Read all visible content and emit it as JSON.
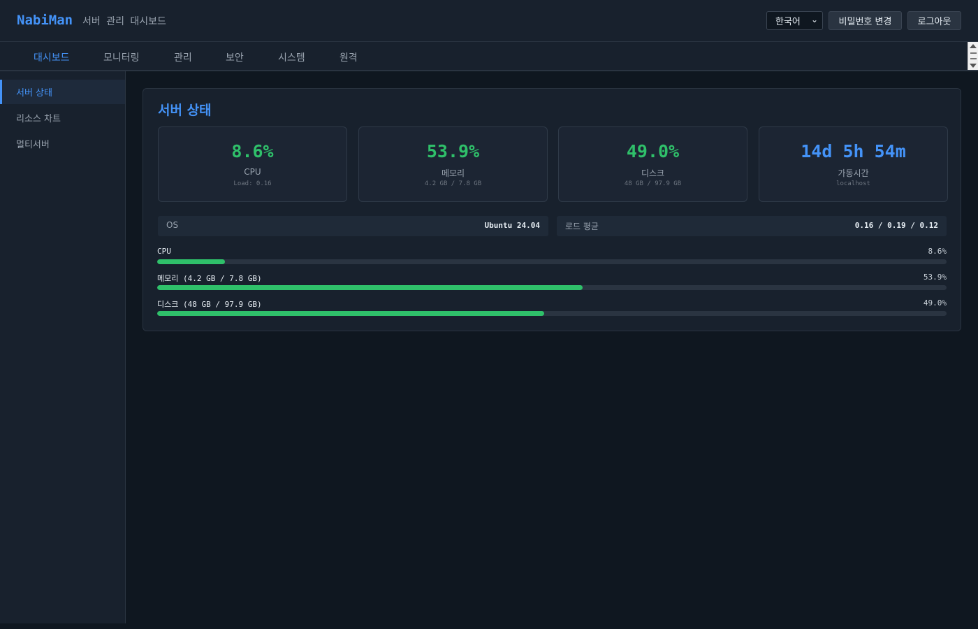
{
  "header": {
    "brand": "NabiMan",
    "subtitle": "서버 관리 대시보드",
    "language": "한국어",
    "change_password": "비밀번호 변경",
    "logout": "로그아웃"
  },
  "tabs": [
    {
      "label": "대시보드",
      "active": true
    },
    {
      "label": "모니터링"
    },
    {
      "label": "관리"
    },
    {
      "label": "보안"
    },
    {
      "label": "시스템"
    },
    {
      "label": "원격"
    }
  ],
  "sidebar": {
    "items": [
      {
        "label": "서버 상태",
        "active": true
      },
      {
        "label": "리소스 차트"
      },
      {
        "label": "멀티서버"
      }
    ]
  },
  "main": {
    "title": "서버 상태",
    "stats": [
      {
        "value": "8.6%",
        "label": "CPU",
        "sub": "Load: 0.16"
      },
      {
        "value": "53.9%",
        "label": "메모리",
        "sub": "4.2 GB / 7.8 GB"
      },
      {
        "value": "49.0%",
        "label": "디스크",
        "sub": "48 GB / 97.9 GB"
      },
      {
        "value": "14d 5h 54m",
        "label": "가동시간",
        "sub": "localhost"
      }
    ],
    "info": {
      "os_label": "OS",
      "os_value": "Ubuntu 24.04",
      "load_label": "로드 평균",
      "load_value": "0.16 / 0.19 / 0.12"
    },
    "bars": [
      {
        "label": "CPU",
        "pct_text": "8.6%",
        "percent": 8.6
      },
      {
        "label": "메모리 (4.2 GB / 7.8 GB)",
        "pct_text": "53.9%",
        "percent": 53.9
      },
      {
        "label": "디스크 (48 GB / 97.9 GB)",
        "pct_text": "49.0%",
        "percent": 49.0
      }
    ]
  },
  "colors": {
    "accent": "#4493f8",
    "good": "#2fc06a"
  }
}
